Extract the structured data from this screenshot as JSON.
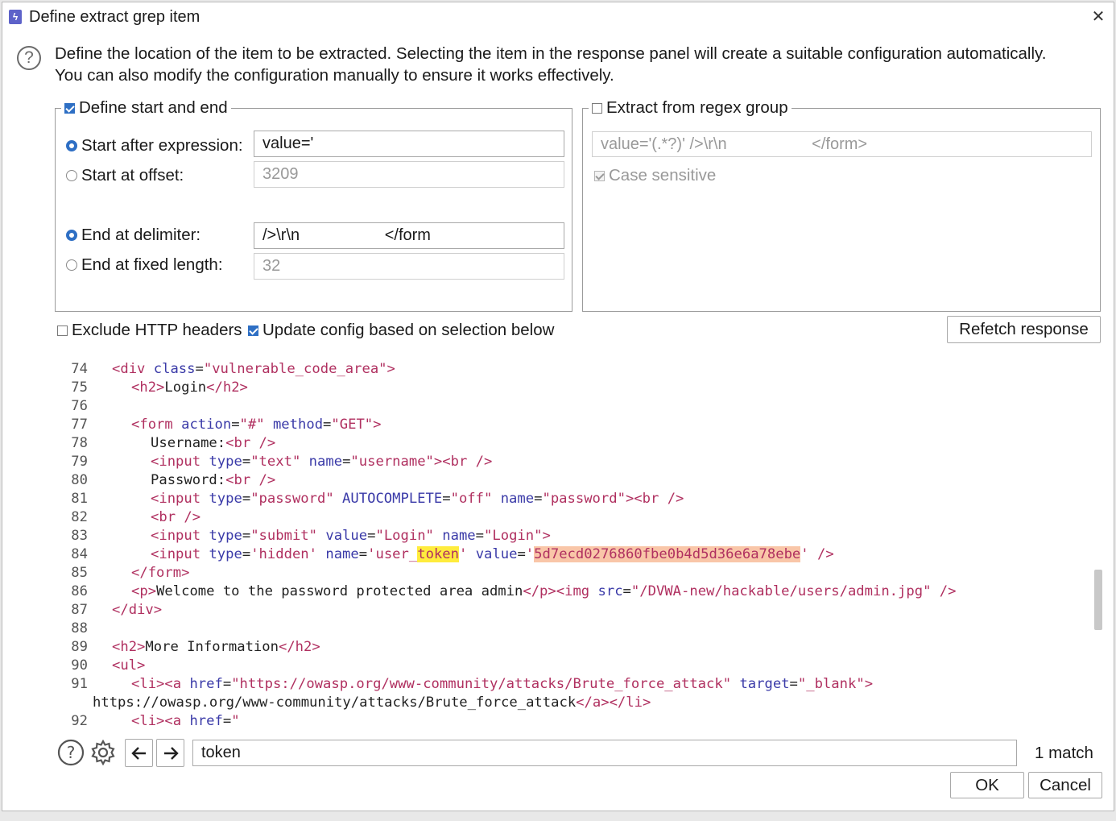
{
  "window": {
    "title": "Define extract grep item",
    "close_glyph": "✕"
  },
  "description": {
    "line1": "Define the location of the item to be extracted. Selecting the item in the response panel will create a suitable configuration automatically.",
    "line2": "You can also modify the configuration manually to ensure it works effectively."
  },
  "start_end": {
    "legend": "Define start and end",
    "checked": true,
    "start_after_label": "Start after expression:",
    "start_after_value": "value='",
    "start_offset_label": "Start at offset:",
    "start_offset_value": "3209",
    "end_delim_label": "End at delimiter:",
    "end_delim_value": "/>\\r\\n                   </form",
    "end_fixed_label": "End at fixed length:",
    "end_fixed_value": "32"
  },
  "regex": {
    "legend": "Extract from regex group",
    "checked": false,
    "value": "value='(.*?)' />\\r\\n                   </form>",
    "case_label": "Case sensitive"
  },
  "options": {
    "exclude_headers": "Exclude HTTP headers",
    "update_config": "Update config based on selection below",
    "refetch": "Refetch response"
  },
  "code_lines": [
    {
      "n": "74",
      "indent": 1,
      "parts": [
        [
          "t",
          "<div "
        ],
        [
          "at",
          "class"
        ],
        [
          "",
          "="
        ],
        [
          "v",
          "\"vulnerable_code_area\""
        ],
        [
          "t",
          ">"
        ]
      ]
    },
    {
      "n": "75",
      "indent": 2,
      "parts": [
        [
          "t",
          "<h2>"
        ],
        [
          "",
          "Login"
        ],
        [
          "t",
          "</h2>"
        ]
      ]
    },
    {
      "n": "76",
      "indent": 0,
      "parts": []
    },
    {
      "n": "77",
      "indent": 2,
      "parts": [
        [
          "t",
          "<form "
        ],
        [
          "at",
          "action"
        ],
        [
          "",
          "="
        ],
        [
          "v",
          "\"#\""
        ],
        [
          "",
          " "
        ],
        [
          "at",
          "method"
        ],
        [
          "",
          "="
        ],
        [
          "v",
          "\"GET\""
        ],
        [
          "t",
          ">"
        ]
      ]
    },
    {
      "n": "78",
      "indent": 3,
      "parts": [
        [
          "",
          "Username:"
        ],
        [
          "t",
          "<br />"
        ]
      ]
    },
    {
      "n": "79",
      "indent": 3,
      "parts": [
        [
          "t",
          "<input "
        ],
        [
          "at",
          "type"
        ],
        [
          "",
          "="
        ],
        [
          "v",
          "\"text\""
        ],
        [
          "",
          " "
        ],
        [
          "at",
          "name"
        ],
        [
          "",
          "="
        ],
        [
          "v",
          "\"username\""
        ],
        [
          "t",
          "><br />"
        ]
      ]
    },
    {
      "n": "80",
      "indent": 3,
      "parts": [
        [
          "",
          "Password:"
        ],
        [
          "t",
          "<br />"
        ]
      ]
    },
    {
      "n": "81",
      "indent": 3,
      "parts": [
        [
          "t",
          "<input "
        ],
        [
          "at",
          "type"
        ],
        [
          "",
          "="
        ],
        [
          "v",
          "\"password\""
        ],
        [
          "",
          " "
        ],
        [
          "at",
          "AUTOCOMPLETE"
        ],
        [
          "",
          "="
        ],
        [
          "v",
          "\"off\""
        ],
        [
          "",
          " "
        ],
        [
          "at",
          "name"
        ],
        [
          "",
          "="
        ],
        [
          "v",
          "\"password\""
        ],
        [
          "t",
          "><br />"
        ]
      ]
    },
    {
      "n": "82",
      "indent": 3,
      "parts": [
        [
          "t",
          "<br />"
        ]
      ]
    },
    {
      "n": "83",
      "indent": 3,
      "parts": [
        [
          "t",
          "<input "
        ],
        [
          "at",
          "type"
        ],
        [
          "",
          "="
        ],
        [
          "v",
          "\"submit\""
        ],
        [
          "",
          " "
        ],
        [
          "at",
          "value"
        ],
        [
          "",
          "="
        ],
        [
          "v",
          "\"Login\""
        ],
        [
          "",
          " "
        ],
        [
          "at",
          "name"
        ],
        [
          "",
          "="
        ],
        [
          "v",
          "\"Login\""
        ],
        [
          "t",
          ">"
        ]
      ]
    },
    {
      "n": "84",
      "indent": 3,
      "parts": [
        [
          "t",
          "<input "
        ],
        [
          "at",
          "type"
        ],
        [
          "",
          "="
        ],
        [
          "v",
          "'hidden'"
        ],
        [
          "",
          " "
        ],
        [
          "at",
          "name"
        ],
        [
          "",
          "="
        ],
        [
          "v",
          "'user_"
        ],
        [
          "vy",
          "token"
        ],
        [
          "v",
          "'"
        ],
        [
          "",
          " "
        ],
        [
          "at",
          "value"
        ],
        [
          "",
          "="
        ],
        [
          "v",
          "'"
        ],
        [
          "vo",
          "5d7ecd0276860fbe0b4d5d36e6a78ebe"
        ],
        [
          "v",
          "'"
        ],
        [
          "",
          " "
        ],
        [
          "t",
          "/>"
        ]
      ]
    },
    {
      "n": "85",
      "indent": 2,
      "parts": [
        [
          "t",
          "</form>"
        ]
      ]
    },
    {
      "n": "86",
      "indent": 2,
      "parts": [
        [
          "t",
          "<p>"
        ],
        [
          "",
          "Welcome to the password protected area admin"
        ],
        [
          "t",
          "</p><img "
        ],
        [
          "at",
          "src"
        ],
        [
          "",
          "="
        ],
        [
          "v",
          "\"/DVWA-new/hackable/users/admin.jpg\""
        ],
        [
          "",
          " "
        ],
        [
          "t",
          "/>"
        ]
      ]
    },
    {
      "n": "87",
      "indent": 1,
      "parts": [
        [
          "t",
          "</div>"
        ]
      ]
    },
    {
      "n": "88",
      "indent": 0,
      "parts": []
    },
    {
      "n": "89",
      "indent": 1,
      "parts": [
        [
          "t",
          "<h2>"
        ],
        [
          "",
          "More Information"
        ],
        [
          "t",
          "</h2>"
        ]
      ]
    },
    {
      "n": "90",
      "indent": 1,
      "parts": [
        [
          "t",
          "<ul>"
        ]
      ]
    },
    {
      "n": "91",
      "indent": 2,
      "parts": [
        [
          "t",
          "<li><a "
        ],
        [
          "at",
          "href"
        ],
        [
          "",
          "="
        ],
        [
          "v",
          "\"https://owasp.org/www-community/attacks/Brute_force_attack\""
        ],
        [
          "",
          " "
        ],
        [
          "at",
          "target"
        ],
        [
          "",
          "="
        ],
        [
          "v",
          "\"_blank\""
        ],
        [
          "t",
          ">"
        ]
      ]
    },
    {
      "n": "",
      "indent": -1,
      "parts": [
        [
          "",
          "https://owasp.org/www-community/attacks/Brute_force_attack"
        ],
        [
          "t",
          "</a></li>"
        ]
      ]
    },
    {
      "n": "92",
      "indent": 2,
      "parts": [
        [
          "t",
          "<li><a "
        ],
        [
          "at",
          "href"
        ],
        [
          "",
          "="
        ],
        [
          "v",
          "\""
        ]
      ]
    }
  ],
  "search": {
    "value": "token",
    "matches": "1 match"
  },
  "buttons": {
    "ok": "OK",
    "cancel": "Cancel"
  }
}
